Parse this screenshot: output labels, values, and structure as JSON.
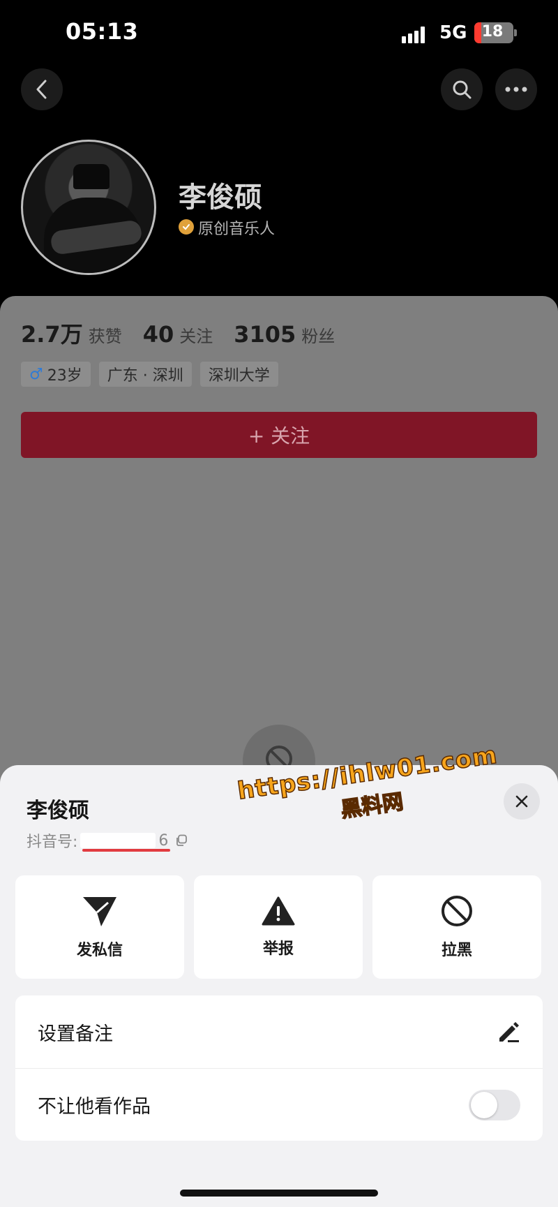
{
  "status_bar": {
    "time": "05:13",
    "network": "5G",
    "battery": "18"
  },
  "header": {
    "back_icon": "chevron-left-icon",
    "search_icon": "search-icon",
    "more_icon": "more-dots-icon"
  },
  "profile": {
    "name": "李俊硕",
    "verified_label": "原创音乐人",
    "stats": [
      {
        "value": "2.7万",
        "label": "获赞"
      },
      {
        "value": "40",
        "label": "关注"
      },
      {
        "value": "3105",
        "label": "粉丝"
      }
    ],
    "tags": [
      {
        "icon": "♂",
        "text": "23岁"
      },
      {
        "icon": "",
        "text": "广东 · 深圳"
      },
      {
        "icon": "",
        "text": "深圳大学"
      }
    ],
    "follow_label": "+ 关注"
  },
  "sheet": {
    "name": "李俊硕",
    "id_prefix": "抖音号: ",
    "id_tail": "6",
    "copy_icon": "copy-icon",
    "close_icon": "close-icon",
    "actions": [
      {
        "label": "发私信",
        "icon": "send-icon"
      },
      {
        "label": "举报",
        "icon": "warning-icon"
      },
      {
        "label": "拉黑",
        "icon": "block-icon"
      }
    ],
    "rows": [
      {
        "label": "设置备注",
        "icon": "edit-icon"
      },
      {
        "label": "不让他看作品",
        "toggle": false
      }
    ]
  },
  "watermark": {
    "url": "https://ihlw01.com",
    "name": "黑料网"
  },
  "colors": {
    "follow_button": "#801526",
    "verified": "#e0a13a",
    "battery_low": "#ff3b30",
    "watermark": "#f7a51c"
  }
}
